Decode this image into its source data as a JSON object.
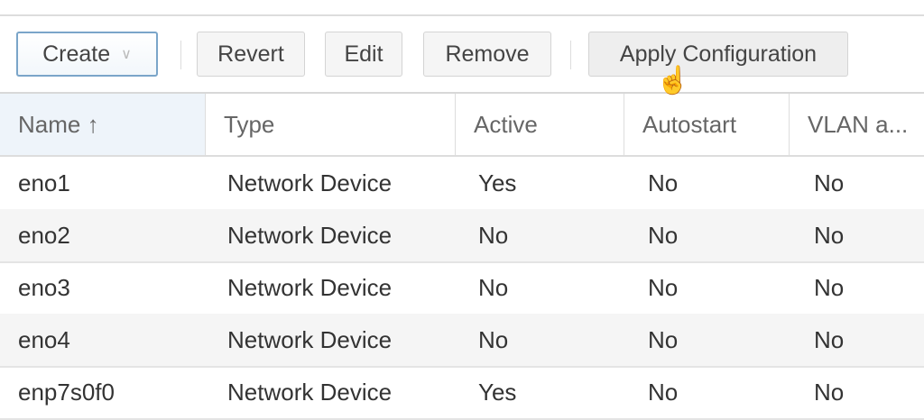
{
  "toolbar": {
    "create": "Create",
    "revert": "Revert",
    "edit": "Edit",
    "remove": "Remove",
    "apply": "Apply Configuration"
  },
  "columns": [
    "Name ↑",
    "Type",
    "Active",
    "Autostart",
    "VLAN a..."
  ],
  "rows": [
    [
      "eno1",
      "Network Device",
      "Yes",
      "No",
      "No"
    ],
    [
      "eno2",
      "Network Device",
      "No",
      "No",
      "No"
    ],
    [
      "eno3",
      "Network Device",
      "No",
      "No",
      "No"
    ],
    [
      "eno4",
      "Network Device",
      "No",
      "No",
      "No"
    ],
    [
      "enp7s0f0",
      "Network Device",
      "Yes",
      "No",
      "No"
    ]
  ]
}
